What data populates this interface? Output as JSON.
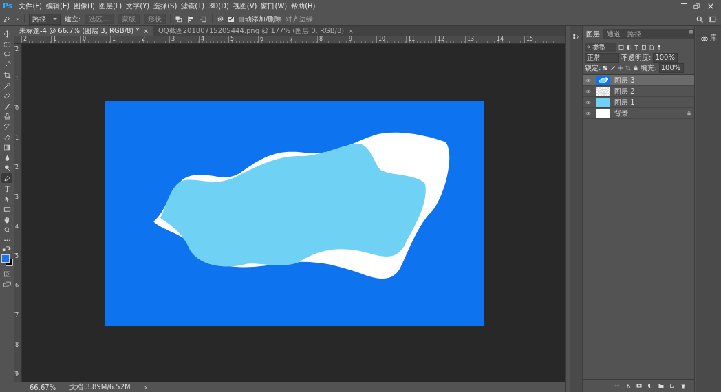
{
  "app": {
    "logo": "Ps"
  },
  "menu": [
    "文件(F)",
    "编辑(E)",
    "图像(I)",
    "图层(L)",
    "文字(Y)",
    "选择(S)",
    "滤镜(T)",
    "3D(D)",
    "视图(V)",
    "窗口(W)",
    "帮助(H)"
  ],
  "options_bar": {
    "mode": "路径",
    "make_label": "建立:",
    "buttons": [
      {
        "label": "选区...",
        "disabled": true
      },
      {
        "label": "蒙版",
        "disabled": true
      },
      {
        "label": "形状",
        "disabled": true
      }
    ],
    "auto_add": {
      "label": "自动添加/删除",
      "checked": true
    },
    "align_edges": {
      "label": "对齐边缘",
      "disabled": true
    }
  },
  "document_tabs": [
    {
      "label": "未标题-4 @ 66.7% (图层 3, RGB/8) *",
      "close": "×",
      "selected": true
    },
    {
      "label": "QQ截图20180715205444.png @ 177% (图层 0, RGB/8)",
      "close": "×",
      "selected": false
    }
  ],
  "ruler_h": [
    "2",
    "1",
    "0",
    "1",
    "2",
    "3",
    "4",
    "5",
    "6",
    "7",
    "8",
    "9",
    "10",
    "11",
    "12",
    "13",
    "14",
    "15"
  ],
  "ruler_v": [
    "2",
    "1",
    "0",
    "1",
    "2",
    "3",
    "4",
    "5",
    "6",
    "7",
    "8",
    "9"
  ],
  "tools": [
    {
      "kind": "move",
      "selected": false
    },
    {
      "kind": "marquee",
      "selected": false
    },
    {
      "kind": "lasso",
      "selected": false
    },
    {
      "kind": "quick-select",
      "selected": false
    },
    {
      "kind": "crop",
      "selected": false
    },
    {
      "kind": "eyedropper",
      "selected": false
    },
    {
      "kind": "healing",
      "selected": false
    },
    {
      "kind": "brush",
      "selected": false
    },
    {
      "kind": "stamp",
      "selected": false
    },
    {
      "kind": "history-brush",
      "selected": false
    },
    {
      "kind": "eraser",
      "selected": false
    },
    {
      "kind": "gradient",
      "selected": false
    },
    {
      "kind": "blur",
      "selected": false
    },
    {
      "kind": "dodge",
      "selected": false
    },
    {
      "kind": "pen",
      "selected": true
    },
    {
      "kind": "type",
      "selected": false
    },
    {
      "kind": "path-select",
      "selected": false
    },
    {
      "kind": "rectangle",
      "selected": false
    },
    {
      "kind": "hand",
      "selected": false
    },
    {
      "kind": "zoom",
      "selected": false
    },
    {
      "kind": "more",
      "selected": false
    }
  ],
  "status_bar": {
    "zoom": "66.67%",
    "doc_size": "文档:3.89M/6.52M",
    "arrow": "›"
  },
  "layers_panel": {
    "tabs": [
      {
        "label": "图层",
        "selected": true
      },
      {
        "label": "通道",
        "selected": false
      },
      {
        "label": "路径",
        "selected": false
      }
    ],
    "filter": "类型",
    "blend_mode": "正常",
    "opacity_label": "不透明度:",
    "opacity": "100%",
    "lock_label": "锁定:",
    "fill_label": "填充:",
    "fill": "100%",
    "layers": [
      {
        "name": "图层 3",
        "kind": "artwork",
        "visible": true,
        "locked": false,
        "selected": true
      },
      {
        "name": "图层 2",
        "kind": "transparent",
        "visible": true,
        "locked": false,
        "selected": false
      },
      {
        "name": "图层 1",
        "kind": "fill",
        "visible": true,
        "locked": false,
        "selected": false
      },
      {
        "name": "背景",
        "kind": "white",
        "visible": true,
        "locked": true,
        "selected": false
      }
    ]
  },
  "libraries": {
    "label": "库"
  }
}
